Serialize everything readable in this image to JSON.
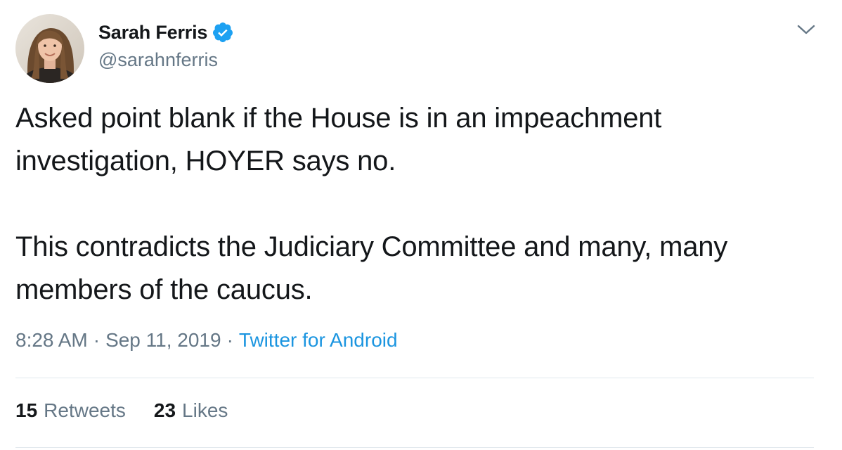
{
  "author": {
    "display_name": "Sarah Ferris",
    "handle": "@sarahnferris",
    "verified": true,
    "avatar_icon": "profile-photo"
  },
  "tweet": {
    "paragraphs": [
      "Asked point blank if the House is in an impeachment investigation, HOYER says no.",
      "This contradicts the Judiciary Committee and many, many members of the caucus."
    ],
    "time": "8:28 AM",
    "separator": "·",
    "date": "Sep 11, 2019",
    "source": "Twitter for Android"
  },
  "stats": {
    "retweets_count": "15",
    "retweets_label": "Retweets",
    "likes_count": "23",
    "likes_label": "Likes"
  },
  "colors": {
    "text_primary": "#14171a",
    "text_secondary": "#657786",
    "link": "#1b95e0",
    "verified_badge": "#1da1f2",
    "divider": "#e1e8ed"
  },
  "icons": {
    "verified": "verified-badge-icon",
    "more": "chevron-down-icon"
  }
}
